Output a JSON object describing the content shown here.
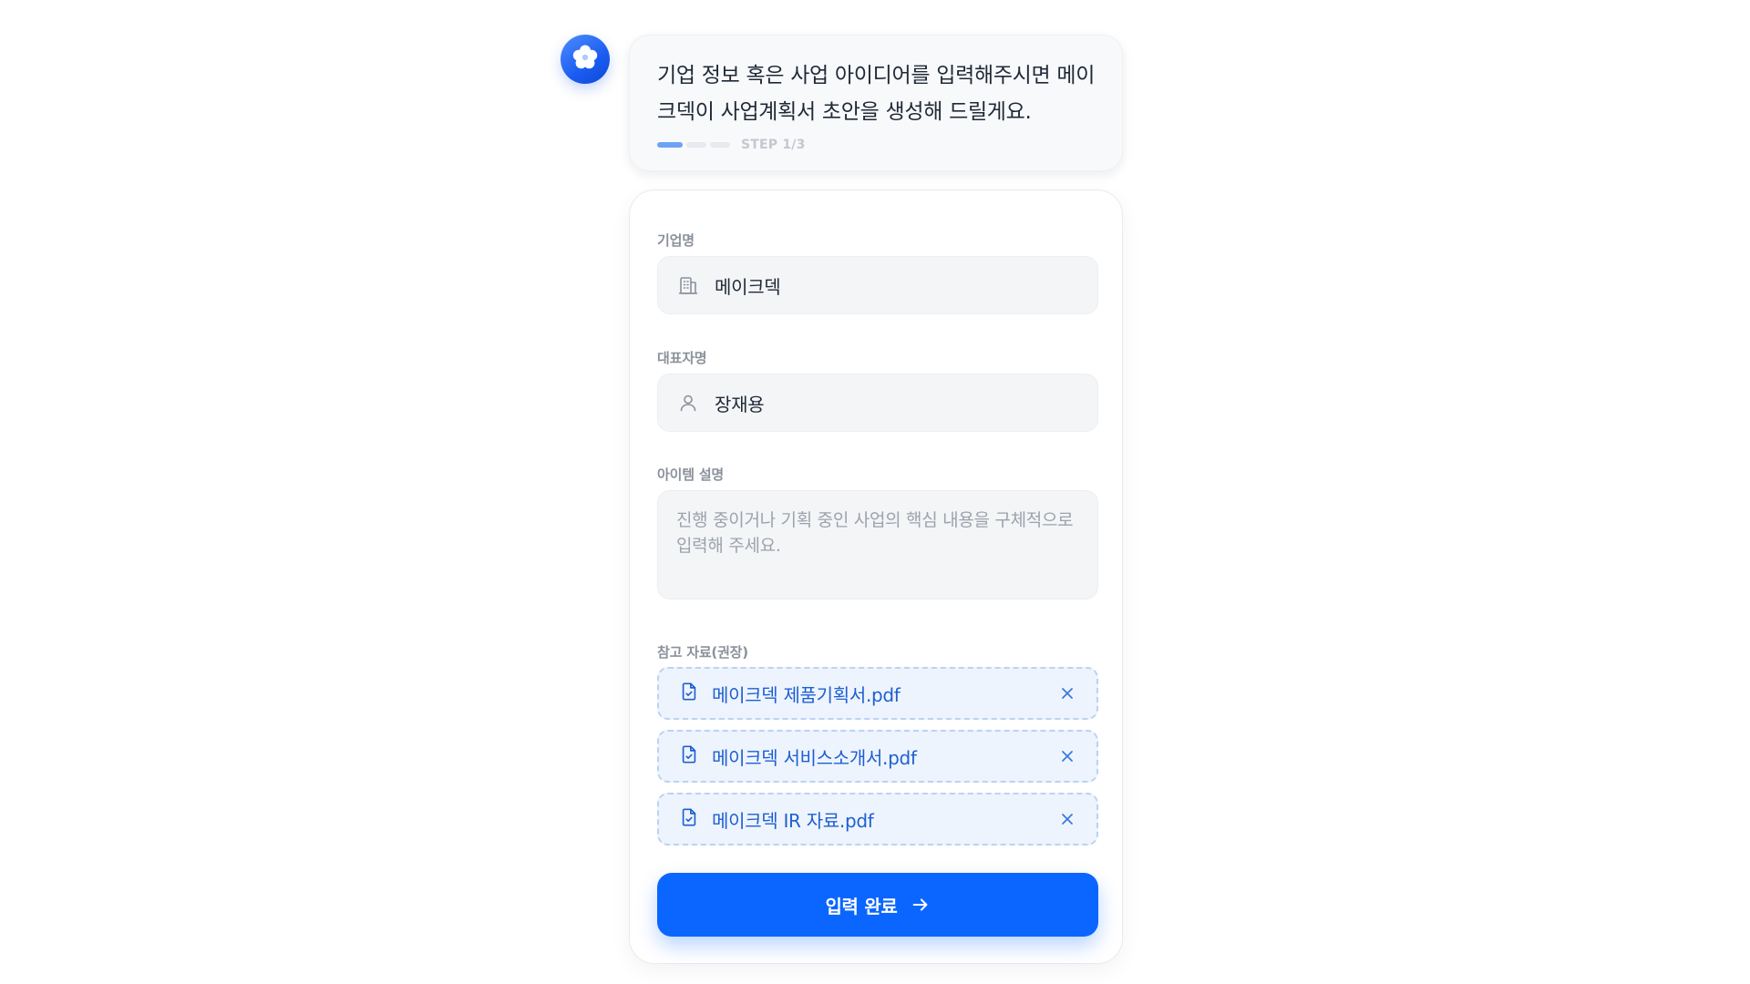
{
  "assistant": {
    "avatar_icon": "flower-logo-icon",
    "message": "기업 정보 혹은 사업 아이디어를 입력해주시면 메이크덱이 사업계획서 초안을 생성해 드릴게요.",
    "progress": {
      "current_step": 1,
      "total_steps": 3,
      "label": "STEP 1/3"
    }
  },
  "form": {
    "company": {
      "label": "기업명",
      "value": "메이크덱",
      "icon": "building-icon"
    },
    "ceo": {
      "label": "대표자명",
      "value": "장재용",
      "icon": "user-icon"
    },
    "item": {
      "label": "아이템 설명",
      "placeholder": "진행 중이거나 기획 중인 사업의 핵심 내용을 구체적으로 입력해 주세요."
    },
    "references": {
      "label": "참고 자료(권장)",
      "files": [
        {
          "name": "메이크덱 제품기획서.pdf",
          "icon": "file-check-icon"
        },
        {
          "name": "메이크덱 서비스소개서.pdf",
          "icon": "file-check-icon"
        },
        {
          "name": "메이크덱 IR 자료.pdf",
          "icon": "file-check-icon"
        }
      ]
    },
    "submit": {
      "label": "입력 완료",
      "icon": "arrow-right-icon"
    }
  },
  "colors": {
    "primary": "#0a66ff",
    "file_text": "#1d5fd3",
    "progress_active": "#6da2f7"
  }
}
